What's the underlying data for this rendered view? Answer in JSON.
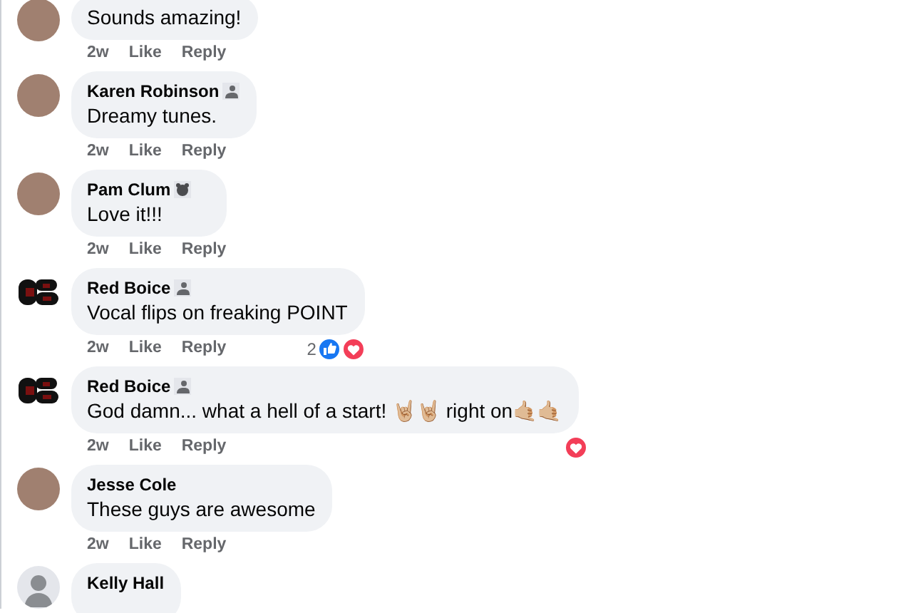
{
  "comments": [
    {
      "text": "Sounds amazing!",
      "avatar": {
        "kind": "photo"
      },
      "time": "2w",
      "like": "Like",
      "reply": "Reply"
    },
    {
      "name": "Karen Robinson",
      "badge": {
        "kind": "fan"
      },
      "text": "Dreamy tunes.",
      "avatar": {
        "kind": "photo"
      },
      "time": "2w",
      "like": "Like",
      "reply": "Reply"
    },
    {
      "name": "Pam Clum",
      "badge": {
        "kind": "other"
      },
      "text": "Love it!!!",
      "avatar": {
        "kind": "photo"
      },
      "time": "2w",
      "like": "Like",
      "reply": "Reply"
    },
    {
      "name": "Red Boice",
      "badge": {
        "kind": "fan"
      },
      "text": "Vocal flips on freaking POINT",
      "avatar": {
        "kind": "logo"
      },
      "time": "2w",
      "like": "Like",
      "reply": "Reply",
      "reactions": {
        "count": "2",
        "types": [
          {
            "kind": "like"
          },
          {
            "kind": "love"
          }
        ]
      }
    },
    {
      "name": "Red Boice",
      "badge": {
        "kind": "fan"
      },
      "text": "God damn... what a hell of a start! 🤘🏼🤘🏼 right on🤙🏼🤙🏼",
      "avatar": {
        "kind": "logo"
      },
      "time": "2w",
      "like": "Like",
      "reply": "Reply",
      "reactions": {
        "types": [
          {
            "kind": "love"
          }
        ]
      }
    },
    {
      "name": "Jesse Cole",
      "text": "These guys are awesome",
      "avatar": {
        "kind": "photo"
      },
      "time": "2w",
      "like": "Like",
      "reply": "Reply"
    },
    {
      "name": "Kelly Hall",
      "avatar": {
        "kind": "default"
      }
    }
  ]
}
